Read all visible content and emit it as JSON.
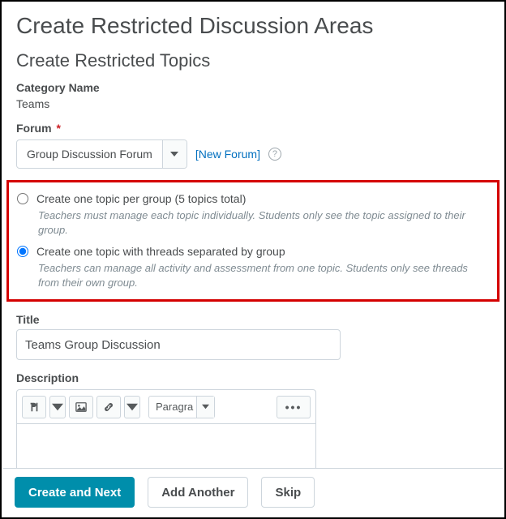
{
  "page_title": "Create Restricted Discussion Areas",
  "section_title": "Create Restricted Topics",
  "category": {
    "label": "Category Name",
    "value": "Teams"
  },
  "forum": {
    "label": "Forum",
    "required_mark": "*",
    "selected": "Group Discussion Forum",
    "new_link": "[New Forum]",
    "help_glyph": "?"
  },
  "topic_mode": {
    "option_per_group": {
      "label": "Create one topic per group (5 topics total)",
      "hint": "Teachers must manage each topic individually. Students only see the topic assigned to their group."
    },
    "option_threads_by_group": {
      "label": "Create one topic with threads separated by group",
      "hint": "Teachers can manage all activity and assessment from one topic. Students only see threads from their own group."
    }
  },
  "title_field": {
    "label": "Title",
    "value": "Teams Group Discussion"
  },
  "description": {
    "label": "Description",
    "paragraph_style": "Paragra",
    "more_glyph": "•••"
  },
  "footer": {
    "create_next": "Create and Next",
    "add_another": "Add Another",
    "skip": "Skip"
  }
}
